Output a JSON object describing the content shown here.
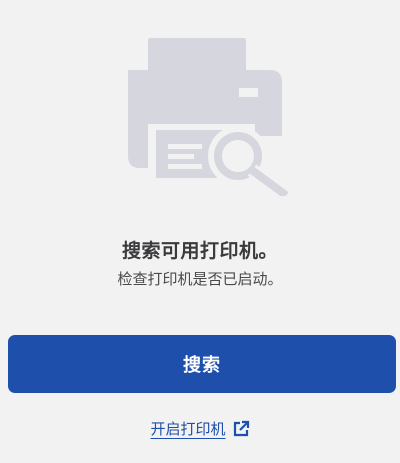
{
  "empty_state": {
    "illustration_icon": "printer-search-icon",
    "title": "搜索可用打印机。",
    "subtitle": "检查打印机是否已启动。"
  },
  "actions": {
    "search_label": "搜索",
    "turn_on_printer_label": "开启打印机",
    "external_link_icon": "external-link-icon"
  },
  "colors": {
    "accent": "#1d4fab",
    "illustration": "#d5d6de",
    "background": "#f2f2f3"
  }
}
